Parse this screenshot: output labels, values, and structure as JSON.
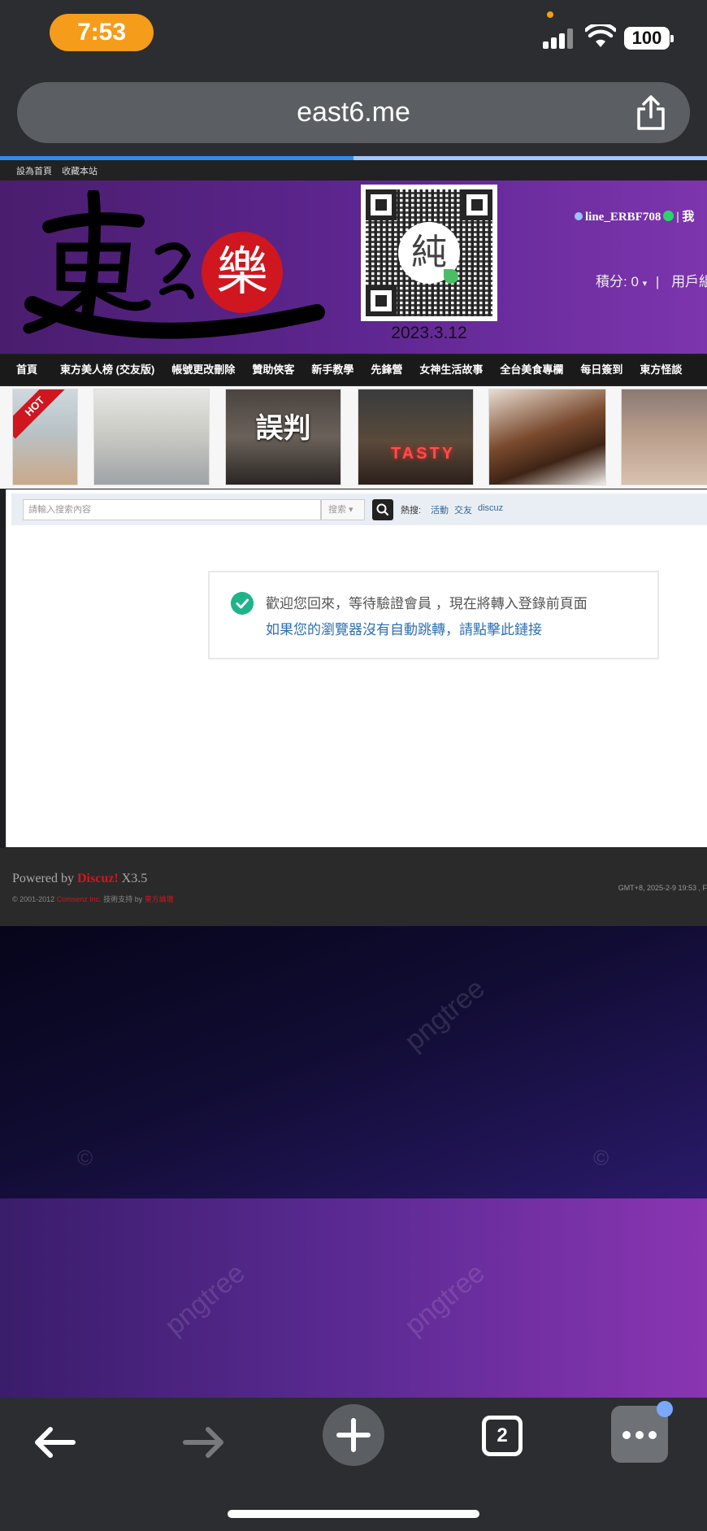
{
  "status_bar": {
    "time": "7:53",
    "battery": "100"
  },
  "browser": {
    "url": "east6.me",
    "tab_count": "2",
    "load_progress": 0.5
  },
  "site": {
    "top_links": [
      "設為首頁",
      "收藏本站"
    ],
    "header": {
      "qr_center_char": "純",
      "qr_date": "2023.3.12",
      "username": "line_ERBF708",
      "user_suffix": "| 我",
      "points_label": "積分: 0",
      "points_caret": "▾",
      "separator": "|",
      "user_group": "用戶組"
    },
    "nav": [
      "首頁",
      "東方美人榜 (交友版)",
      "帳號更改刪除",
      "贊助俠客",
      "新手教學",
      "先鋒營",
      "女神生活故事",
      "全台美食專欄",
      "每日簽到",
      "東方怪談"
    ],
    "thumbnails": {
      "hot_badge": "HOT",
      "movie_title": "誤判",
      "restaurant_sign": "TASTY"
    },
    "search": {
      "placeholder": "請輸入搜索內容",
      "select_label": "搜索",
      "hot_label": "熱搜:",
      "hot_links": [
        "活動",
        "交友",
        "discuz"
      ]
    },
    "message": {
      "line1": "歡迎您回來，等待驗證會員 ，現在將轉入登錄前頁面",
      "line2": "如果您的瀏覽器沒有自動跳轉，請點擊此鏈接"
    },
    "footer": {
      "powered_prefix": "Powered by ",
      "powered_brand": "Discuz!",
      "powered_version": " X3.5",
      "copyright_prefix": "© 2001-2012 ",
      "copyright_company": "Comsenz Inc.",
      "support_prefix": "  技術支持 by ",
      "support_brand": "東方論壇",
      "timestamp": "GMT+8, 2025-2-9 19:53 , F"
    }
  },
  "background": {
    "watermark": "pngtree"
  },
  "colors": {
    "accent_orange": "#f59c1a",
    "header_purple": "#5d2690",
    "success_green": "#1fb389",
    "link_blue": "#2f6fb0",
    "discuz_red": "#d0161f"
  },
  "icons": {
    "back": "arrow-left-icon",
    "forward": "arrow-right-icon",
    "new_tab": "plus-icon",
    "tabs": "tab-counter-icon",
    "menu": "more-dots-icon",
    "share": "share-icon"
  }
}
